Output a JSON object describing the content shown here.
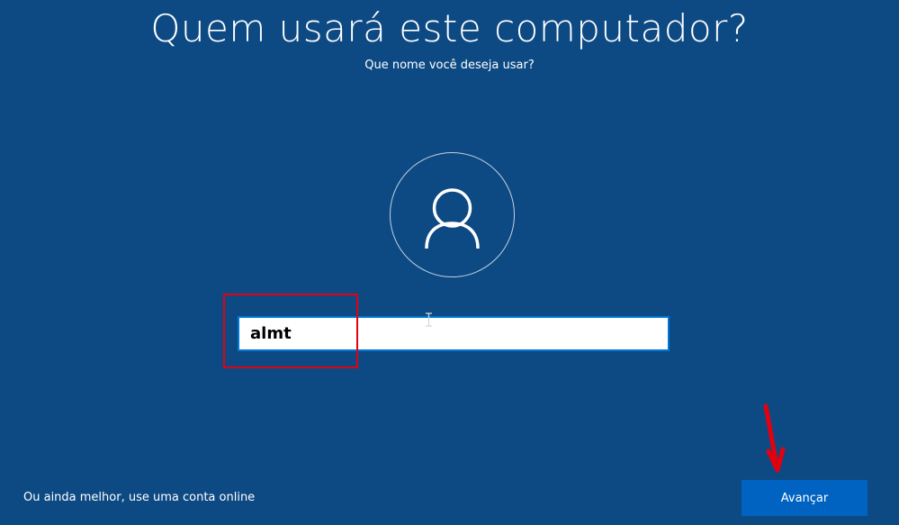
{
  "page": {
    "title": "Quem usará este computador?",
    "subtitle": "Que nome você deseja usar?"
  },
  "avatar": {
    "icon": "user-icon"
  },
  "name_field": {
    "value": "almt"
  },
  "footer": {
    "online_account_link": "Ou ainda melhor, use uma conta online",
    "next_button": "Avançar"
  },
  "annotations": {
    "highlight_color": "#e3000f",
    "arrow_color": "#e3000f"
  },
  "colors": {
    "background": "#0d4a84",
    "accent": "#0078d7",
    "button": "#0063c1"
  }
}
